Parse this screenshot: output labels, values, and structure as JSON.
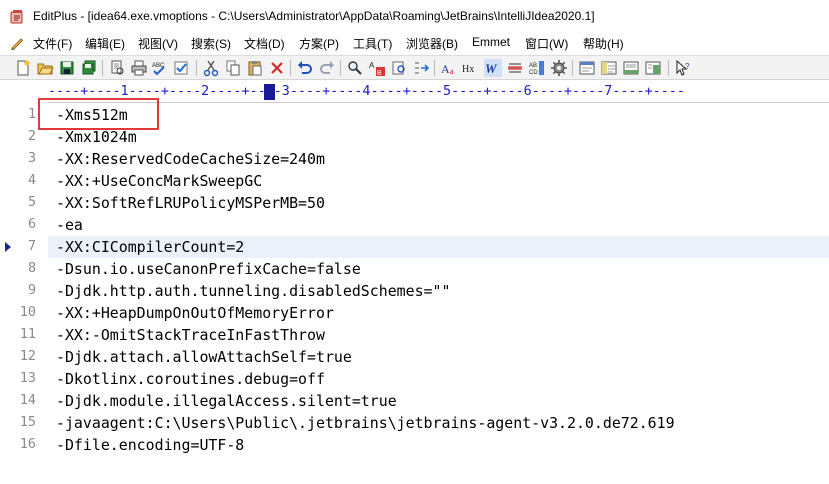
{
  "window": {
    "app_name": "EditPlus",
    "title": "EditPlus - [idea64.exe.vmoptions - C:\\Users\\Administrator\\AppData\\Roaming\\JetBrains\\IntelliJIdea2020.1]"
  },
  "menu": [
    {
      "label": "文件(F)"
    },
    {
      "label": "编辑(E)"
    },
    {
      "label": "视图(V)"
    },
    {
      "label": "搜索(S)"
    },
    {
      "label": "文档(D)"
    },
    {
      "label": "方案(P)"
    },
    {
      "label": "工具(T)"
    },
    {
      "label": "浏览器(B)"
    },
    {
      "label": "Emmet"
    },
    {
      "label": "窗口(W)"
    },
    {
      "label": "帮助(H)"
    }
  ],
  "toolbar_icons": [
    "new-file-icon",
    "open-folder-icon",
    "save-icon",
    "save-all-icon",
    "print-preview-icon",
    "print-icon",
    "spell-check-icon",
    "check-icon",
    "cut-icon",
    "copy-icon",
    "paste-icon",
    "delete-icon",
    "undo-icon",
    "redo-icon",
    "find-icon",
    "replace-icon",
    "find-in-files-icon",
    "goto-icon",
    "font-icon",
    "hex-icon",
    "word-wrap-icon",
    "line-numbers-icon",
    "abcd-column-icon",
    "settings-icon",
    "view-1-icon",
    "view-2-icon",
    "view-3-icon",
    "view-4-icon",
    "pointer-help-icon"
  ],
  "ruler": {
    "text": "----+----1----+----2----+----3----+----4----+----5----+----6----+----7----+----"
  },
  "editor": {
    "current_line": 7,
    "lines": [
      {
        "num": "1",
        "text": "-Xms512m"
      },
      {
        "num": "2",
        "text": "-Xmx1024m"
      },
      {
        "num": "3",
        "text": "-XX:ReservedCodeCacheSize=240m"
      },
      {
        "num": "4",
        "text": "-XX:+UseConcMarkSweepGC"
      },
      {
        "num": "5",
        "text": "-XX:SoftRefLRUPolicyMSPerMB=50"
      },
      {
        "num": "6",
        "text": "-ea"
      },
      {
        "num": "7",
        "text": "-XX:CICompilerCount=2"
      },
      {
        "num": "8",
        "text": "-Dsun.io.useCanonPrefixCache=false"
      },
      {
        "num": "9",
        "text": "-Djdk.http.auth.tunneling.disabledSchemes=\"\""
      },
      {
        "num": "10",
        "text": "-XX:+HeapDumpOnOutOfMemoryError"
      },
      {
        "num": "11",
        "text": "-XX:-OmitStackTraceInFastThrow"
      },
      {
        "num": "12",
        "text": "-Djdk.attach.allowAttachSelf=true"
      },
      {
        "num": "13",
        "text": "-Dkotlinx.coroutines.debug=off"
      },
      {
        "num": "14",
        "text": "-Djdk.module.illegalAccess.silent=true"
      },
      {
        "num": "15",
        "text": "-javaagent:C:\\Users\\Public\\.jetbrains\\jetbrains-agent-v3.2.0.de72.619"
      },
      {
        "num": "16",
        "text": "-Dfile.encoding=UTF-8"
      }
    ]
  },
  "colors": {
    "highlight_box": "#e23a3a",
    "current_line_bg": "#eaf1fb",
    "ruler": "#1a1ad6",
    "line_number": "#8a8a8a"
  }
}
